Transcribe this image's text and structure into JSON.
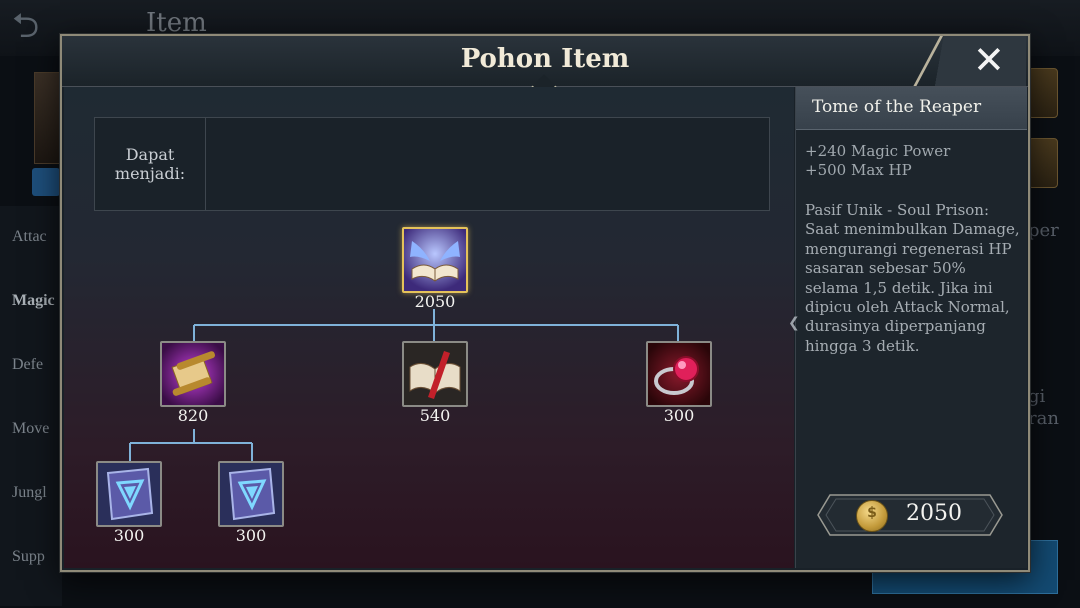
{
  "background": {
    "screen_title": "Item",
    "categories": [
      "Attac",
      "Magic",
      "Defe",
      "Move",
      "Jungl",
      "Supp"
    ],
    "right_text_1": "per",
    "right_text_2": "gi",
    "right_text_3": "ran"
  },
  "modal": {
    "title": "Pohon Item",
    "close_label": "✕",
    "can_become_label": "Dapat menjadi:"
  },
  "tree": {
    "root": {
      "icon": "winged-book-icon",
      "price": "2050"
    },
    "children": [
      {
        "icon": "magic-scroll-icon",
        "price": "820"
      },
      {
        "icon": "open-book-icon",
        "price": "540"
      },
      {
        "icon": "ruby-ring-icon",
        "price": "300"
      }
    ],
    "grandchildren": [
      {
        "icon": "mystery-codex-icon",
        "price": "300"
      },
      {
        "icon": "mystery-codex-icon",
        "price": "300"
      }
    ]
  },
  "detail": {
    "item_name": "Tome of the Reaper",
    "stats": [
      "+240 Magic Power",
      "+500 Max HP"
    ],
    "passive": "Pasif Unik - Soul Prison: Saat menimbulkan Damage, mengurangi regenerasi HP sasaran sebesar 50% selama 1,5 detik. Jika ini dipicu oleh Attack Normal, durasinya diperpanjang hingga 3 detik.",
    "price": "2050",
    "coin_icon": "gold-coin-icon"
  },
  "colors": {
    "root_border": "#e4c25a",
    "tree_line": "#7fb2d9",
    "modal_border": "#8f8a78"
  }
}
